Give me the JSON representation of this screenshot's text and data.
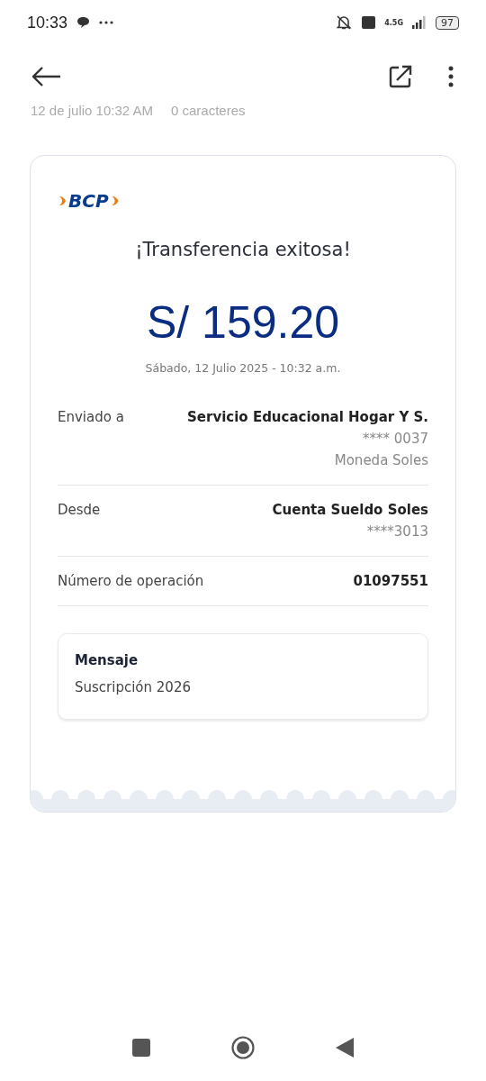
{
  "status_bar": {
    "time": "10:33",
    "battery": "97",
    "network": "4.5G"
  },
  "header_meta": {
    "date": "12 de julio  10:32 AM",
    "chars": "0 caracteres"
  },
  "receipt": {
    "brand": "BCP",
    "title": "¡Transferencia exitosa!",
    "amount": "S/ 159.20",
    "datetime": "Sábado, 12 Julio 2025 - 10:32 a.m.",
    "details": [
      {
        "label": "Enviado a",
        "values": [
          {
            "text": "Servicio Educacional Hogar Y S.",
            "kind": "primary"
          },
          {
            "text": "**** 0037",
            "kind": "secondary"
          },
          {
            "text": "Moneda Soles",
            "kind": "secondary"
          }
        ]
      },
      {
        "label": "Desde",
        "values": [
          {
            "text": "Cuenta Sueldo Soles",
            "kind": "primary"
          },
          {
            "text": "****3013",
            "kind": "secondary"
          }
        ]
      },
      {
        "label": "Número de operación",
        "values": [
          {
            "text": "01097551",
            "kind": "primary"
          }
        ]
      }
    ],
    "message": {
      "title": "Mensaje",
      "text": "Suscripción 2026"
    }
  }
}
